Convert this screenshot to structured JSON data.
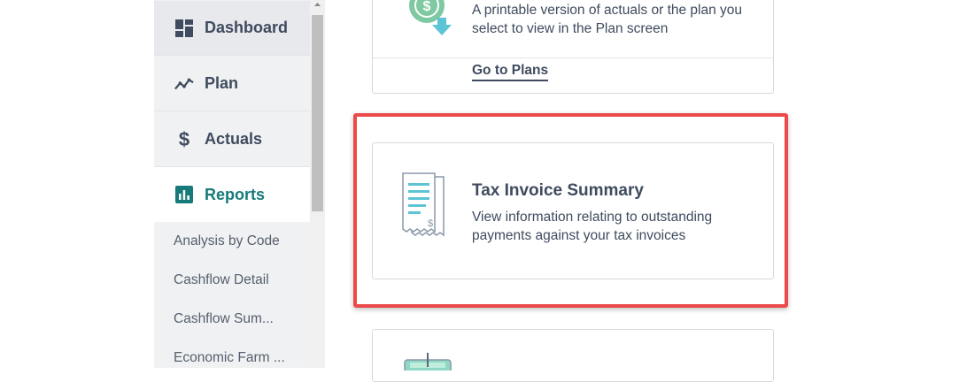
{
  "sidebar": {
    "items": [
      {
        "label": "Dashboard",
        "icon": "dashboard-icon"
      },
      {
        "label": "Plan",
        "icon": "trend-line-icon"
      },
      {
        "label": "Actuals",
        "icon": "dollar-icon"
      },
      {
        "label": "Reports",
        "icon": "bar-chart-icon"
      }
    ],
    "subitems": [
      {
        "label": "Analysis by Code"
      },
      {
        "label": "Cashflow Detail"
      },
      {
        "label": "Cashflow Sum..."
      },
      {
        "label": "Economic Farm ..."
      }
    ]
  },
  "cards": {
    "plan_printable": {
      "description": "A printable version of actuals or the plan you select to view in the Plan screen",
      "link_label": "Go to Plans",
      "icon": "dollar-download-icon"
    },
    "tax_invoice": {
      "title": "Tax Invoice Summary",
      "description": "View information relating to outstanding payments against your tax invoices",
      "icon": "receipt-icon"
    },
    "next": {
      "icon": "calculator-icon"
    }
  },
  "colors": {
    "accent": "#167a7a",
    "highlight": "#ec4a4a",
    "text": "#3f4b5e",
    "sidebar_bg": "#f0f1f3"
  }
}
